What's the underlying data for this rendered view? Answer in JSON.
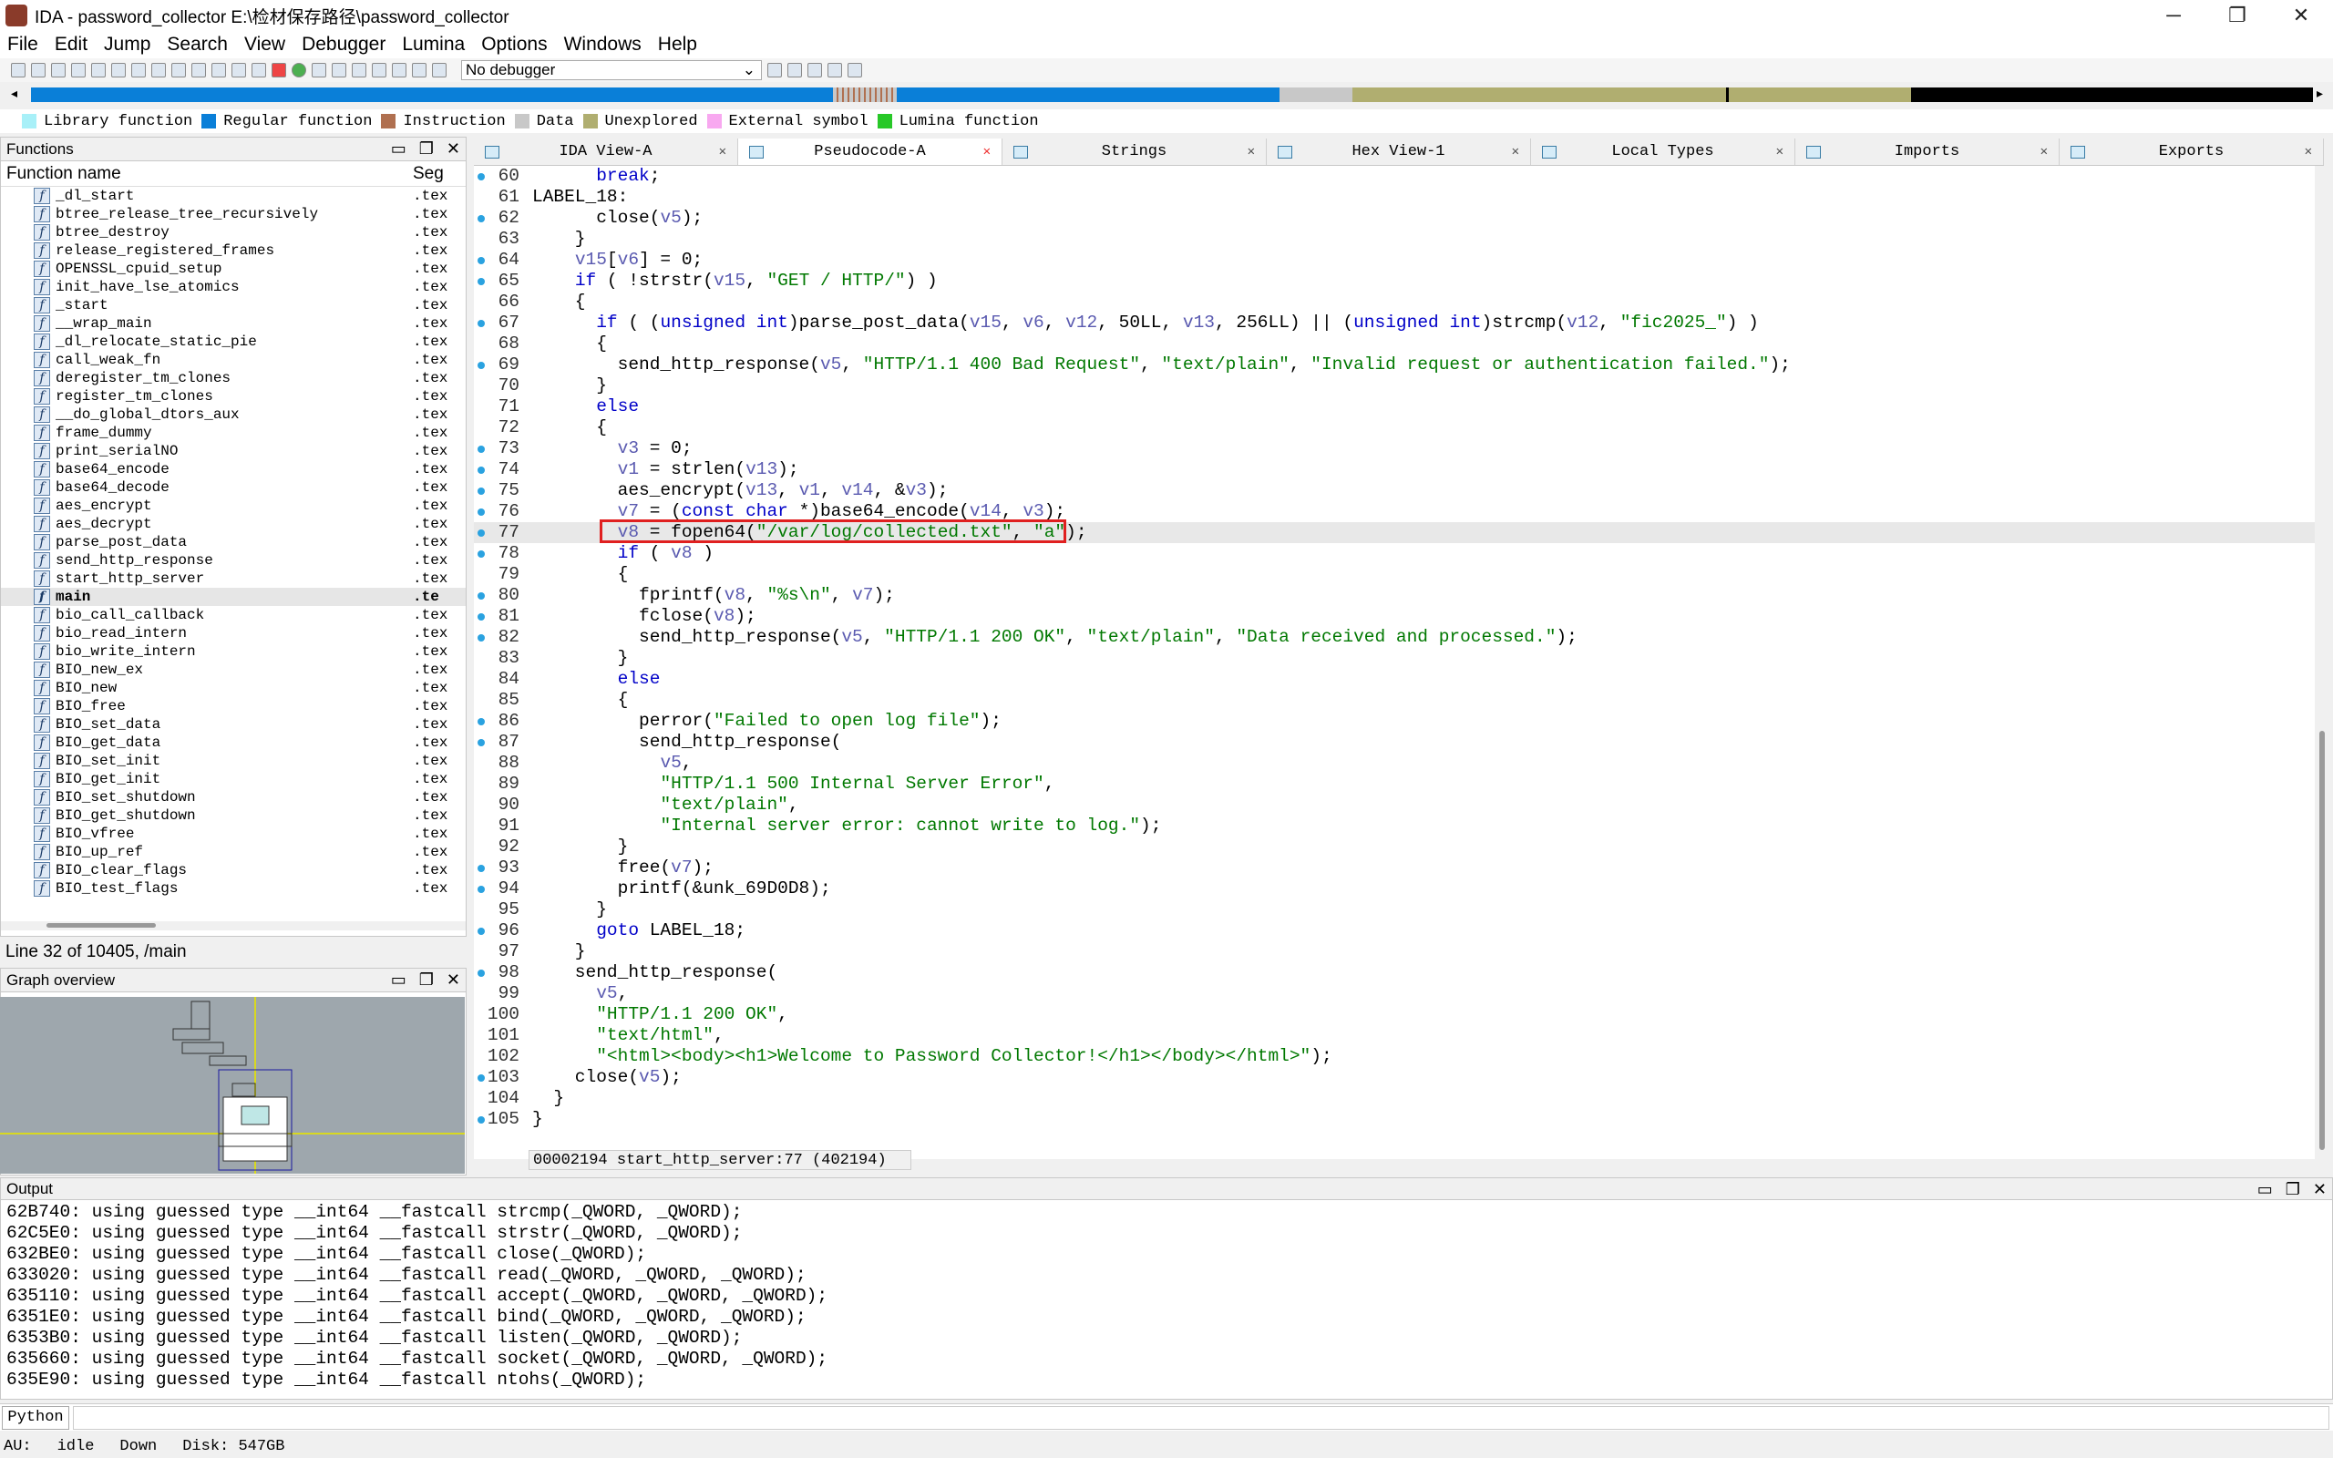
{
  "window": {
    "title": "IDA - password_collector E:\\检材保存路径\\password_collector",
    "minimize": "─",
    "maximize": "❐",
    "close": "✕"
  },
  "menu": [
    "File",
    "Edit",
    "Jump",
    "Search",
    "View",
    "Debugger",
    "Lumina",
    "Options",
    "Windows",
    "Help"
  ],
  "toolbar": {
    "debugger_select": "No debugger"
  },
  "legend": [
    {
      "label": "Library function",
      "color": "#a8f0f8"
    },
    {
      "label": "Regular function",
      "color": "#0a7fd8"
    },
    {
      "label": "Instruction",
      "color": "#b07050"
    },
    {
      "label": "Data",
      "color": "#c8c8c8"
    },
    {
      "label": "Unexplored",
      "color": "#b0ae70"
    },
    {
      "label": "External symbol",
      "color": "#f8a8f0"
    },
    {
      "label": "Lumina function",
      "color": "#28c828"
    }
  ],
  "functions_panel": {
    "title": "Functions",
    "col_name": "Function name",
    "col_seg": "Seg",
    "items": [
      {
        "name": "_dl_start",
        "seg": ".tex"
      },
      {
        "name": "btree_release_tree_recursively",
        "seg": ".tex"
      },
      {
        "name": "btree_destroy",
        "seg": ".tex"
      },
      {
        "name": "release_registered_frames",
        "seg": ".tex"
      },
      {
        "name": "OPENSSL_cpuid_setup",
        "seg": ".tex"
      },
      {
        "name": "init_have_lse_atomics",
        "seg": ".tex"
      },
      {
        "name": "_start",
        "seg": ".tex"
      },
      {
        "name": "__wrap_main",
        "seg": ".tex"
      },
      {
        "name": "_dl_relocate_static_pie",
        "seg": ".tex"
      },
      {
        "name": "call_weak_fn",
        "seg": ".tex"
      },
      {
        "name": "deregister_tm_clones",
        "seg": ".tex"
      },
      {
        "name": "register_tm_clones",
        "seg": ".tex"
      },
      {
        "name": "__do_global_dtors_aux",
        "seg": ".tex"
      },
      {
        "name": "frame_dummy",
        "seg": ".tex"
      },
      {
        "name": "print_serialNO",
        "seg": ".tex"
      },
      {
        "name": "base64_encode",
        "seg": ".tex"
      },
      {
        "name": "base64_decode",
        "seg": ".tex"
      },
      {
        "name": "aes_encrypt",
        "seg": ".tex"
      },
      {
        "name": "aes_decrypt",
        "seg": ".tex"
      },
      {
        "name": "parse_post_data",
        "seg": ".tex"
      },
      {
        "name": "send_http_response",
        "seg": ".tex"
      },
      {
        "name": "start_http_server",
        "seg": ".tex"
      },
      {
        "name": "main",
        "seg": ".te"
      },
      {
        "name": "bio_call_callback",
        "seg": ".tex"
      },
      {
        "name": "bio_read_intern",
        "seg": ".tex"
      },
      {
        "name": "bio_write_intern",
        "seg": ".tex"
      },
      {
        "name": "BIO_new_ex",
        "seg": ".tex"
      },
      {
        "name": "BIO_new",
        "seg": ".tex"
      },
      {
        "name": "BIO_free",
        "seg": ".tex"
      },
      {
        "name": "BIO_set_data",
        "seg": ".tex"
      },
      {
        "name": "BIO_get_data",
        "seg": ".tex"
      },
      {
        "name": "BIO_set_init",
        "seg": ".tex"
      },
      {
        "name": "BIO_get_init",
        "seg": ".tex"
      },
      {
        "name": "BIO_set_shutdown",
        "seg": ".tex"
      },
      {
        "name": "BIO_get_shutdown",
        "seg": ".tex"
      },
      {
        "name": "BIO_vfree",
        "seg": ".tex"
      },
      {
        "name": "BIO_up_ref",
        "seg": ".tex"
      },
      {
        "name": "BIO_clear_flags",
        "seg": ".tex"
      },
      {
        "name": "BIO_test_flags",
        "seg": ".tex"
      }
    ],
    "status": "Line 32 of 10405, /main"
  },
  "graph_panel": {
    "title": "Graph overview"
  },
  "tabs": [
    {
      "label": "IDA View-A"
    },
    {
      "label": "Pseudocode-A"
    },
    {
      "label": "Strings"
    },
    {
      "label": "Hex View-1"
    },
    {
      "label": "Local Types"
    },
    {
      "label": "Imports"
    },
    {
      "label": "Exports"
    }
  ],
  "code": [
    {
      "n": "60",
      "dot": true,
      "t": "      break;"
    },
    {
      "n": "61",
      "dot": false,
      "t": "LABEL_18:"
    },
    {
      "n": "62",
      "dot": true,
      "t": "      close(v5);"
    },
    {
      "n": "63",
      "dot": false,
      "t": "    }"
    },
    {
      "n": "64",
      "dot": true,
      "t": "    v15[v6] = 0;"
    },
    {
      "n": "65",
      "dot": true,
      "t": "    if ( !strstr(v15, \"GET / HTTP/\") )"
    },
    {
      "n": "66",
      "dot": false,
      "t": "    {"
    },
    {
      "n": "67",
      "dot": true,
      "t": "      if ( (unsigned int)parse_post_data(v15, v6, v12, 50LL, v13, 256LL) || (unsigned int)strcmp(v12, \"fic2025_\") )"
    },
    {
      "n": "68",
      "dot": false,
      "t": "      {"
    },
    {
      "n": "69",
      "dot": true,
      "t": "        send_http_response(v5, \"HTTP/1.1 400 Bad Request\", \"text/plain\", \"Invalid request or authentication failed.\");"
    },
    {
      "n": "70",
      "dot": false,
      "t": "      }"
    },
    {
      "n": "71",
      "dot": false,
      "t": "      else"
    },
    {
      "n": "72",
      "dot": false,
      "t": "      {"
    },
    {
      "n": "73",
      "dot": true,
      "t": "        v3 = 0;"
    },
    {
      "n": "74",
      "dot": true,
      "t": "        v1 = strlen(v13);"
    },
    {
      "n": "75",
      "dot": true,
      "t": "        aes_encrypt(v13, v1, v14, &v3);"
    },
    {
      "n": "76",
      "dot": true,
      "t": "        v7 = (const char *)base64_encode(v14, v3);"
    },
    {
      "n": "77",
      "dot": true,
      "t": "        v8 = fopen64(\"/var/log/collected.txt\", \"a\");"
    },
    {
      "n": "78",
      "dot": true,
      "t": "        if ( v8 )"
    },
    {
      "n": "79",
      "dot": false,
      "t": "        {"
    },
    {
      "n": "80",
      "dot": true,
      "t": "          fprintf(v8, \"%s\\n\", v7);"
    },
    {
      "n": "81",
      "dot": true,
      "t": "          fclose(v8);"
    },
    {
      "n": "82",
      "dot": true,
      "t": "          send_http_response(v5, \"HTTP/1.1 200 OK\", \"text/plain\", \"Data received and processed.\");"
    },
    {
      "n": "83",
      "dot": false,
      "t": "        }"
    },
    {
      "n": "84",
      "dot": false,
      "t": "        else"
    },
    {
      "n": "85",
      "dot": false,
      "t": "        {"
    },
    {
      "n": "86",
      "dot": true,
      "t": "          perror(\"Failed to open log file\");"
    },
    {
      "n": "87",
      "dot": true,
      "t": "          send_http_response("
    },
    {
      "n": "88",
      "dot": false,
      "t": "            v5,"
    },
    {
      "n": "89",
      "dot": false,
      "t": "            \"HTTP/1.1 500 Internal Server Error\","
    },
    {
      "n": "90",
      "dot": false,
      "t": "            \"text/plain\","
    },
    {
      "n": "91",
      "dot": false,
      "t": "            \"Internal server error: cannot write to log.\");"
    },
    {
      "n": "92",
      "dot": false,
      "t": "        }"
    },
    {
      "n": "93",
      "dot": true,
      "t": "        free(v7);"
    },
    {
      "n": "94",
      "dot": true,
      "t": "        printf(&unk_69D0D8);"
    },
    {
      "n": "95",
      "dot": false,
      "t": "      }"
    },
    {
      "n": "96",
      "dot": true,
      "t": "      goto LABEL_18;"
    },
    {
      "n": "97",
      "dot": false,
      "t": "    }"
    },
    {
      "n": "98",
      "dot": true,
      "t": "    send_http_response("
    },
    {
      "n": "99",
      "dot": false,
      "t": "      v5,"
    },
    {
      "n": "100",
      "dot": false,
      "t": "      \"HTTP/1.1 200 OK\","
    },
    {
      "n": "101",
      "dot": false,
      "t": "      \"text/html\","
    },
    {
      "n": "102",
      "dot": false,
      "t": "      \"<html><body><h1>Welcome to Password Collector!</h1></body></html>\");"
    },
    {
      "n": "103",
      "dot": true,
      "t": "    close(v5);"
    },
    {
      "n": "104",
      "dot": false,
      "t": "  }"
    },
    {
      "n": "105",
      "dot": true,
      "t": "}"
    }
  ],
  "current_line": "77",
  "address_bar": "00002194 start_http_server:77 (402194)",
  "output_panel": {
    "title": "Output",
    "lines": [
      "62B740: using guessed type __int64 __fastcall strcmp(_QWORD, _QWORD);",
      "62C5E0: using guessed type __int64 __fastcall strstr(_QWORD, _QWORD);",
      "632BE0: using guessed type __int64 __fastcall close(_QWORD);",
      "633020: using guessed type __int64 __fastcall read(_QWORD, _QWORD, _QWORD);",
      "635110: using guessed type __int64 __fastcall accept(_QWORD, _QWORD, _QWORD);",
      "6351E0: using guessed type __int64 __fastcall bind(_QWORD, _QWORD, _QWORD);",
      "6353B0: using guessed type __int64 __fastcall listen(_QWORD, _QWORD);",
      "635660: using guessed type __int64 __fastcall socket(_QWORD, _QWORD, _QWORD);",
      "635E90: using guessed type __int64 __fastcall ntohs(_QWORD);"
    ]
  },
  "python_label": "Python",
  "statusbar": {
    "au": "AU:",
    "state": "idle",
    "dir": "Down",
    "disk": "Disk: 547GB"
  }
}
